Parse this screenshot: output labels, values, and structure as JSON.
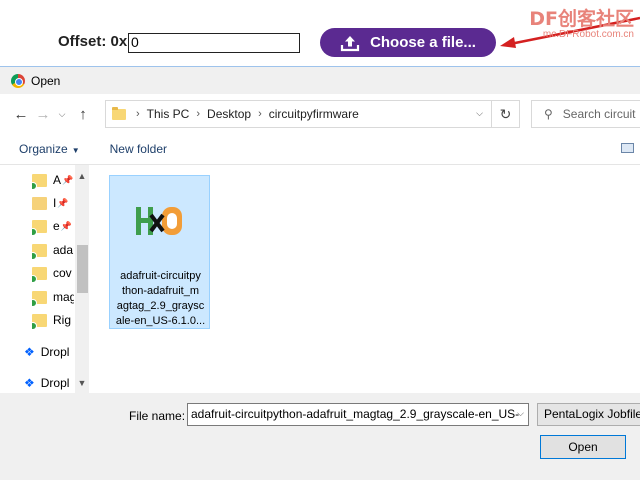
{
  "page": {
    "offset_label": "Offset: 0x",
    "offset_value": "0",
    "choose_button": "Choose a file...",
    "watermark_logo": "DF创客社区",
    "watermark_url": "mc.DFRobot.com.cn",
    "arrow_color": "#d42020",
    "accent_purple": "#5b2a91"
  },
  "dialog": {
    "title": "Open",
    "title_icon": "chrome-icon",
    "breadcrumbs": [
      "This PC",
      "Desktop",
      "circuitpyfirmware"
    ],
    "search_placeholder": "Search circuit",
    "toolbar": {
      "organize": "Organize",
      "new_folder": "New folder"
    },
    "nav_items": [
      {
        "label": "A",
        "icon": "folder-icon",
        "synced": true,
        "pinned": true
      },
      {
        "label": "I",
        "icon": "folder-icon",
        "synced": false,
        "pinned": true
      },
      {
        "label": "e",
        "icon": "folder-icon",
        "synced": true,
        "pinned": true
      },
      {
        "label": "ada",
        "icon": "folder-icon",
        "synced": true,
        "pinned": false
      },
      {
        "label": "cov",
        "icon": "folder-icon",
        "synced": true,
        "pinned": false
      },
      {
        "label": "mag",
        "icon": "folder-icon",
        "synced": true,
        "pinned": false
      },
      {
        "label": "Rig",
        "icon": "folder-icon",
        "synced": true,
        "pinned": false
      },
      {
        "label": "Dropl",
        "icon": "dropbox-icon"
      },
      {
        "label": "Dropl",
        "icon": "dropbox-icon"
      }
    ],
    "file": {
      "icon": "hxd-icon",
      "name_lines": [
        "adafruit-circuitpy",
        "thon-adafruit_m",
        "agtag_2.9_graysc",
        "ale-en_US-6.1.0..."
      ]
    },
    "file_name_label": "File name:",
    "file_name_value": "adafruit-circuitpython-adafruit_magtag_2.9_grayscale-en_US-",
    "file_type_filter": "PentaLogix Jobfile",
    "open_button": "Open"
  }
}
